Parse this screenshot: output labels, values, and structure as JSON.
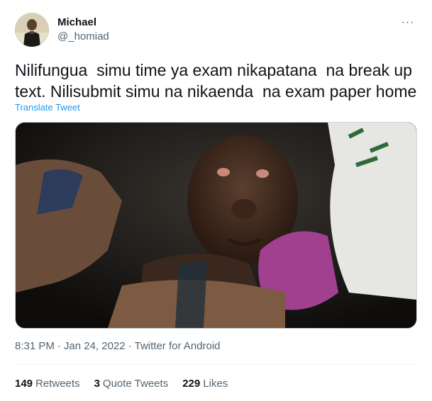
{
  "author": {
    "name": "Michael",
    "handle": "@_homiad",
    "avatar_icon": "profile-photo"
  },
  "menu": {
    "more_label": "···"
  },
  "tweet": {
    "text": "Nilifungua  simu time ya exam nikapatana  na break up\ntext. Nilisubmit simu na nikaenda  na exam paper home",
    "translate_label": "Translate Tweet"
  },
  "meta": {
    "time": "8:31 PM",
    "sep1": "·",
    "date": "Jan 24, 2022",
    "sep2": "·",
    "source": "Twitter for Android"
  },
  "stats": {
    "retweets_count": "149",
    "retweets_label": "Retweets",
    "quotes_count": "3",
    "quotes_label": "Quote Tweets",
    "likes_count": "229",
    "likes_label": "Likes"
  },
  "colors": {
    "link": "#1d9bf0",
    "secondary_text": "#536471",
    "primary_text": "#0f1419",
    "divider": "#eff3f4"
  }
}
